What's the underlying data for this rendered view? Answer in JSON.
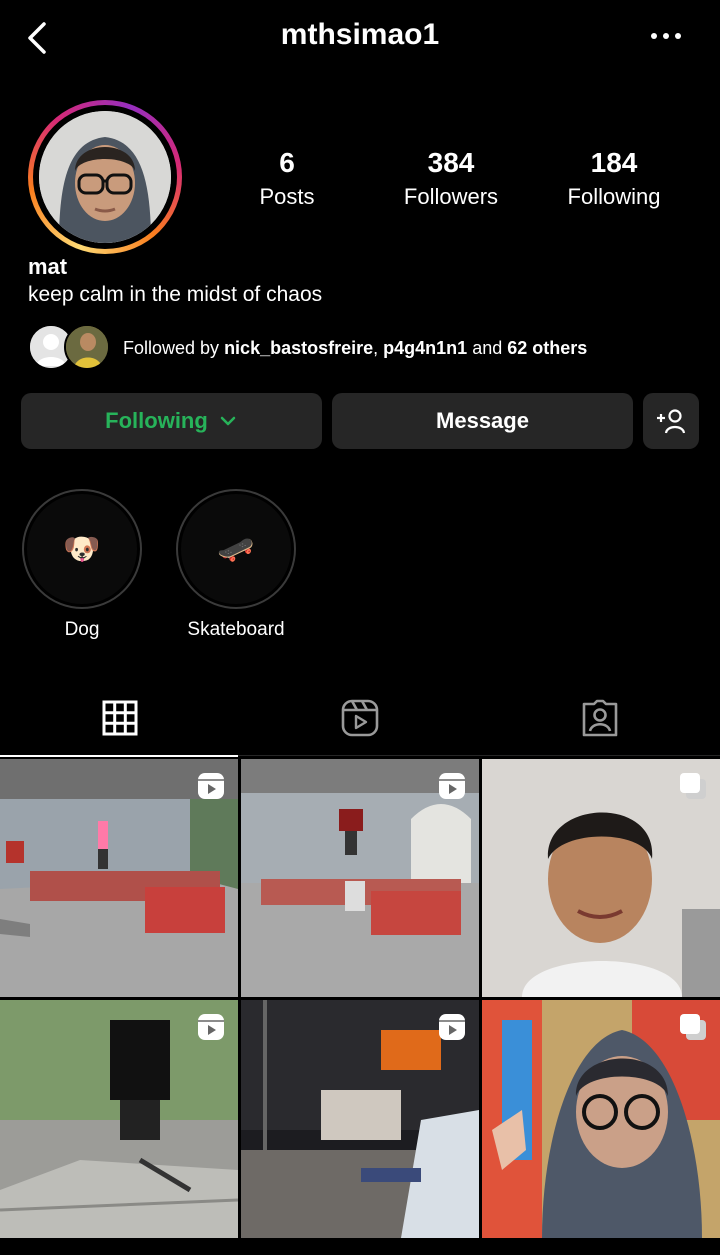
{
  "header": {
    "username": "mthsimao1",
    "back_icon": "chevron-left-icon",
    "more_icon": "more-horizontal-icon"
  },
  "stats": {
    "posts": {
      "value": "6",
      "label": "Posts"
    },
    "followers": {
      "value": "384",
      "label": "Followers"
    },
    "following": {
      "value": "184",
      "label": "Following"
    }
  },
  "profile": {
    "name": "mat",
    "bio": "keep calm in the midst of chaos"
  },
  "followed_by": {
    "prefix": "Followed by ",
    "user1": "nick_bastosfreire",
    "sep": ", ",
    "user2": "p4g4n1n1",
    "and": " and ",
    "others": "62 others"
  },
  "actions": {
    "following_label": "Following",
    "message_label": "Message",
    "add_icon": "add-person-icon"
  },
  "highlights": [
    {
      "label": "Dog",
      "emoji": "🐶"
    },
    {
      "label": "Skateboard",
      "emoji": "🛹"
    }
  ],
  "tabs": [
    "grid-icon",
    "reels-icon",
    "tagged-icon"
  ],
  "posts": [
    {
      "type": "reel",
      "subject": "skatepark"
    },
    {
      "type": "reel",
      "subject": "skatepark-jump"
    },
    {
      "type": "carousel",
      "subject": "selfie"
    },
    {
      "type": "reel",
      "subject": "stairs-skate"
    },
    {
      "type": "reel",
      "subject": "night-skate"
    },
    {
      "type": "carousel",
      "subject": "selfie-glasses"
    }
  ],
  "colors": {
    "background": "#000000",
    "button_bg": "#262626",
    "following_green": "#27b35a"
  }
}
